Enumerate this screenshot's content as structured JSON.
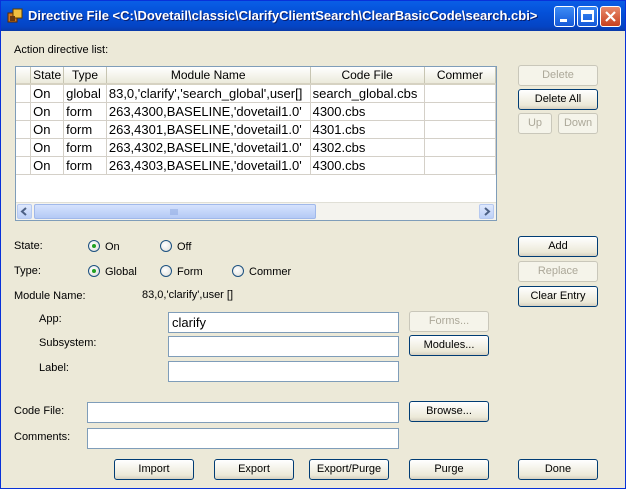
{
  "window": {
    "title": "Directive File <C:\\Dovetail\\classic\\ClarifyClientSearch\\ClearBasicCode\\search.cbi>"
  },
  "list": {
    "label": "Action directive list:",
    "columns": [
      "",
      "State",
      "Type",
      "Module Name",
      "Code File",
      "Commer"
    ],
    "rows": [
      {
        "state": "On",
        "type": "global",
        "module": "83,0,'clarify','search_global',user[]",
        "code_file": "search_global.cbs"
      },
      {
        "state": "On",
        "type": "form",
        "module": "263,4300,BASELINE,'dovetail1.0'",
        "code_file": "4300.cbs"
      },
      {
        "state": "On",
        "type": "form",
        "module": "263,4301,BASELINE,'dovetail1.0'",
        "code_file": "4301.cbs"
      },
      {
        "state": "On",
        "type": "form",
        "module": "263,4302,BASELINE,'dovetail1.0'",
        "code_file": "4302.cbs"
      },
      {
        "state": "On",
        "type": "form",
        "module": "263,4303,BASELINE,'dovetail1.0'",
        "code_file": "4300.cbs"
      }
    ]
  },
  "side_buttons": {
    "delete": "Delete",
    "delete_all": "Delete All",
    "up": "Up",
    "down": "Down",
    "add": "Add",
    "replace": "Replace",
    "clear_entry": "Clear Entry"
  },
  "state": {
    "label": "State:",
    "on": "On",
    "off": "Off",
    "selected": "On"
  },
  "type": {
    "label": "Type:",
    "global": "Global",
    "form": "Form",
    "commer": "Commer",
    "selected": "Global"
  },
  "module_name": {
    "label": "Module Name:",
    "value": "83,0,'clarify',user []"
  },
  "fields": {
    "app_label": "App:",
    "app_value": "clarify",
    "subsystem_label": "Subsystem:",
    "subsystem_value": "",
    "label_label": "Label:",
    "label_value": "",
    "code_file_label": "Code File:",
    "code_file_value": "",
    "comments_label": "Comments:",
    "comments_value": ""
  },
  "mid_buttons": {
    "forms": "Forms...",
    "modules": "Modules...",
    "browse": "Browse..."
  },
  "bottom_buttons": {
    "import": "Import",
    "export": "Export",
    "export_purge": "Export/Purge",
    "purge": "Purge",
    "done": "Done"
  }
}
